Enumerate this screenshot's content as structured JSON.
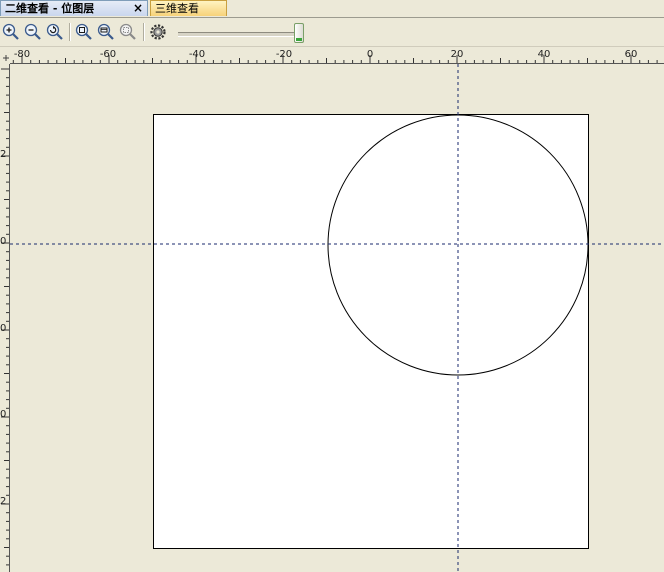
{
  "tabs": [
    {
      "label": "二维查看 - 位图层",
      "active": true
    },
    {
      "label": "三维查看",
      "active": false
    }
  ],
  "tab_close_glyph": "×",
  "toolbar": {
    "buttons": [
      {
        "name": "zoom-in-button",
        "icon": "zoom-in-icon"
      },
      {
        "name": "zoom-out-button",
        "icon": "zoom-out-icon"
      },
      {
        "name": "zoom-reset-button",
        "icon": "zoom-refresh-icon"
      },
      {
        "name": "zoom-fit-button",
        "icon": "zoom-fit-icon"
      },
      {
        "name": "zoom-window-button",
        "icon": "zoom-window-icon"
      },
      {
        "name": "zoom-area-button",
        "icon": "zoom-area-icon"
      },
      {
        "name": "settings-button",
        "icon": "gear-icon"
      }
    ],
    "slider_level": 1.0
  },
  "ruler": {
    "top_labels": [
      "-80",
      "-60",
      "-40",
      "-20",
      "0",
      "20",
      "40",
      "60"
    ],
    "left_labels": [
      "2",
      "0",
      "0",
      "0",
      "2"
    ]
  },
  "colors": {
    "background": "#ECE9D8",
    "canvas": "#FFFFFF",
    "crosshair": "#1A2A6C",
    "shape_stroke": "#000000"
  }
}
